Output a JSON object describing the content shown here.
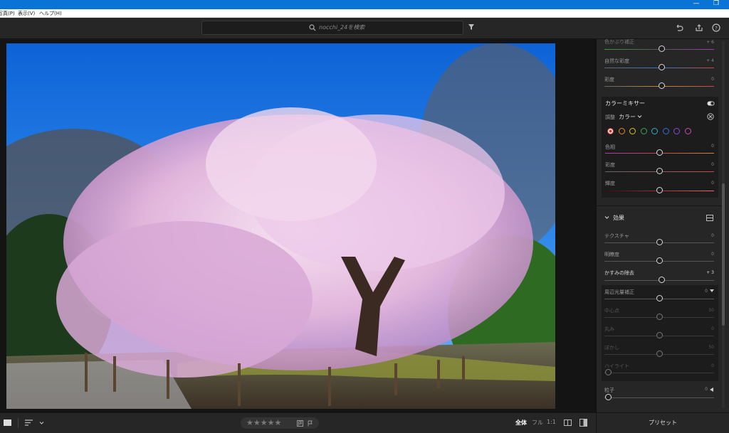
{
  "window": {
    "minimize": "—",
    "restore": "❐"
  },
  "menu": {
    "items": [
      "写真(P)",
      "表示(V)",
      "ヘルプ(H)"
    ]
  },
  "search": {
    "placeholder": "nocchi_24を検索"
  },
  "panel": {
    "top_sliders": [
      {
        "label": "色かぶり補正",
        "value": "+ 6",
        "pos": 0.5
      },
      {
        "label": "自然な彩度",
        "value": "+ 4",
        "pos": 0.5
      },
      {
        "label": "彩度",
        "value": "0",
        "pos": 0.5
      }
    ],
    "color_mixer": {
      "title": "カラーミキサー",
      "adjust_label": "調整",
      "adjust_value": "カラー",
      "swatches": [
        "#d93030",
        "#e08a20",
        "#d8c020",
        "#3aa84a",
        "#2ab3c8",
        "#3a6ee0",
        "#8a4ad8",
        "#c84ab8"
      ],
      "sliders": [
        {
          "label": "色相",
          "value": "0",
          "pos": 0.5
        },
        {
          "label": "彩度",
          "value": "0",
          "pos": 0.5
        },
        {
          "label": "輝度",
          "value": "0",
          "pos": 0.5
        }
      ]
    },
    "effects": {
      "title": "効果",
      "sliders": [
        {
          "label": "テクスチャ",
          "value": "0",
          "pos": 0.5
        },
        {
          "label": "明瞭度",
          "value": "0",
          "pos": 0.5
        },
        {
          "label": "かすみの除去",
          "value": "+ 3",
          "pos": 0.5
        }
      ],
      "vignette": {
        "label": "周辺光量補正",
        "value": "0",
        "sub": [
          {
            "label": "中心点",
            "value": "50",
            "pos": 0.5
          },
          {
            "label": "丸み",
            "value": "0",
            "pos": 0.5
          },
          {
            "label": "ぼかし",
            "value": "50",
            "pos": 0.5
          },
          {
            "label": "ハイライト",
            "value": "0",
            "pos": 0.0
          }
        ]
      },
      "grain": {
        "label": "粒子",
        "value": "0",
        "pos": 0.0
      }
    }
  },
  "bottom": {
    "view_all": "全体",
    "view_full": "フル",
    "view_1to1": "1:1",
    "presets": "プリセット",
    "stars": "★★★★★"
  }
}
